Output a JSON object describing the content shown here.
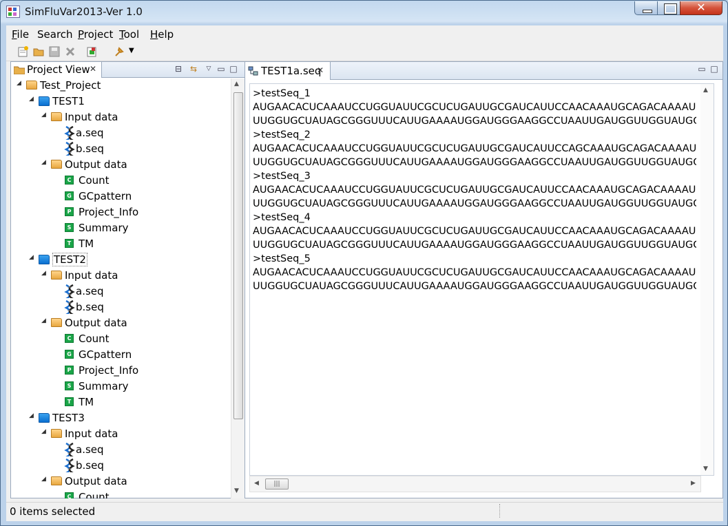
{
  "window": {
    "title": "SimFluVar2013-Ver 1.0"
  },
  "menu": [
    {
      "key": "F",
      "rest": "ile"
    },
    {
      "key": "S",
      "rest": "earch",
      "plain": true
    },
    {
      "key": "P",
      "rest": "roject"
    },
    {
      "key": "T",
      "rest": "ool"
    },
    {
      "key": "H",
      "rest": "elp"
    }
  ],
  "menu_labels": [
    "File",
    "Search",
    "Project",
    "Tool",
    "Help"
  ],
  "project_view": {
    "title": "Project View",
    "tree": [
      {
        "label": "Test_Project",
        "level": 0,
        "icon": "folder-open-icon"
      },
      {
        "label": "TEST1",
        "level": 1,
        "icon": "project-folder-icon"
      },
      {
        "label": "Input data",
        "level": 2,
        "icon": "folder-open-icon"
      },
      {
        "label": "a.seq",
        "level": 3,
        "icon": "dna-icon"
      },
      {
        "label": "b.seq",
        "level": 3,
        "icon": "dna-icon"
      },
      {
        "label": "Output data",
        "level": 2,
        "icon": "folder-open-icon"
      },
      {
        "label": "Count",
        "level": 3,
        "icon": "file-c-icon",
        "letter": "C"
      },
      {
        "label": "GCpattern",
        "level": 3,
        "icon": "file-g-icon",
        "letter": "G"
      },
      {
        "label": "Project_Info",
        "level": 3,
        "icon": "file-p-icon",
        "letter": "P"
      },
      {
        "label": "Summary",
        "level": 3,
        "icon": "file-s-icon",
        "letter": "S"
      },
      {
        "label": "TM",
        "level": 3,
        "icon": "file-t-icon",
        "letter": "T"
      },
      {
        "label": "TEST2",
        "level": 1,
        "icon": "project-folder-icon",
        "selected": true
      },
      {
        "label": "Input data",
        "level": 2,
        "icon": "folder-open-icon"
      },
      {
        "label": "a.seq",
        "level": 3,
        "icon": "dna-icon"
      },
      {
        "label": "b.seq",
        "level": 3,
        "icon": "dna-icon"
      },
      {
        "label": "Output data",
        "level": 2,
        "icon": "folder-open-icon"
      },
      {
        "label": "Count",
        "level": 3,
        "icon": "file-c-icon",
        "letter": "C"
      },
      {
        "label": "GCpattern",
        "level": 3,
        "icon": "file-g-icon",
        "letter": "G"
      },
      {
        "label": "Project_Info",
        "level": 3,
        "icon": "file-p-icon",
        "letter": "P"
      },
      {
        "label": "Summary",
        "level": 3,
        "icon": "file-s-icon",
        "letter": "S"
      },
      {
        "label": "TM",
        "level": 3,
        "icon": "file-t-icon",
        "letter": "T"
      },
      {
        "label": "TEST3",
        "level": 1,
        "icon": "project-folder-icon"
      },
      {
        "label": "Input data",
        "level": 2,
        "icon": "folder-open-icon"
      },
      {
        "label": "a.seq",
        "level": 3,
        "icon": "dna-icon"
      },
      {
        "label": "b.seq",
        "level": 3,
        "icon": "dna-icon"
      },
      {
        "label": "Output data",
        "level": 2,
        "icon": "folder-open-icon"
      },
      {
        "label": "Count",
        "level": 3,
        "icon": "file-c-icon",
        "letter": "C"
      }
    ]
  },
  "editor": {
    "tab_title": "TEST1a.seq",
    "lines": [
      ">testSeq_1",
      "AUGAACACUCAAAUCCUGGUAUUCGCUCUGAUUGCGAUCAUUCCAACAAAUGCAGACAAAAU",
      "UUGGUGCUAUAGCGGGUUUCAUUGAAAAUGGAUGGGAAGGCCUAAUUGAUGGUUGGUAUGG",
      ">testSeq_2",
      "AUGAACACUCAAAUCCUGGUAUUCGCUCUGAUUGCGAUCAUUCCAGCAAAUGCAGACAAAAU",
      "UUGGUGCUAUAGCGGGUUUCAUUGAAAAUGGAUGGGAAGGCCUAAUUGAUGGUUGGUAUGG",
      ">testSeq_3",
      "AUGAACACUCAAAUCCUGGUAUUCGCUCUGAUUGCGAUCAUUCCAACAAAUGCAGACAAAAU",
      "UUGGUGCUAUAGCGGGUUUCAUUGAAAAUGGAUGGGAAGGCCUAAUUGAUGGUUGGUAUGG",
      ">testSeq_4",
      "AUGAACACUCAAAUCCUGGUAUUCGCUCUGAUUGCGAUCAUUCCAACAAAUGCAGACAAAAU",
      "UUGGUGCUAUAGCGGGUUUCAUUGAAAAUGGAUGGGAAGGCCUAAUUGAUGGUUGGUAUGG",
      ">testSeq_5",
      "AUGAACACUCAAAUCCUGGUAUUCGCUCUGAUUGCGAUCAUUCCAACAAAUGCAGACAAAAU",
      "UUGGUGCUAUAGCGGGUUUCAUUGAAAAUGGAUGGGAAGGCCUAAUUGAUGGUUGGUAUGG"
    ]
  },
  "status": {
    "text": "0 items selected"
  },
  "colors": {
    "accent": "#0a6fd0",
    "selection_border": "#7a7a7a"
  }
}
